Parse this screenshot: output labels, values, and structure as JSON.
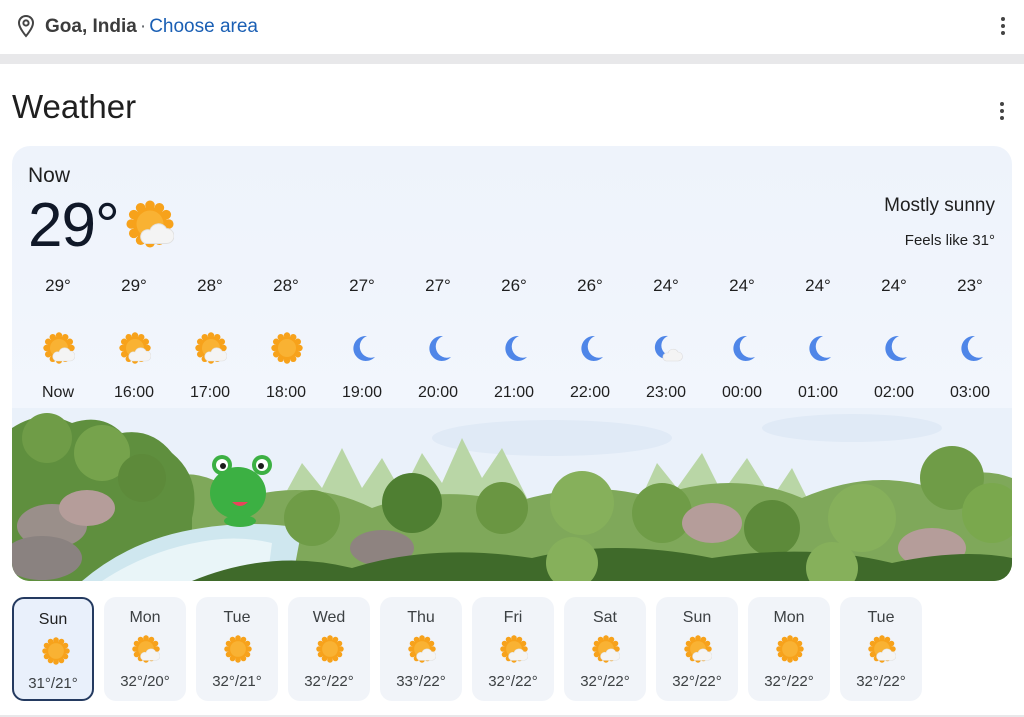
{
  "location": {
    "city": "Goa, India",
    "separator": "·",
    "choose": "Choose area"
  },
  "card_title": "Weather",
  "current": {
    "label": "Now",
    "temp": "29°",
    "condition": "Mostly sunny",
    "feels_like": "Feels like 31°",
    "icon": "sun-cloud-icon"
  },
  "hourly": [
    {
      "temp": "29°",
      "time": "Now",
      "icon": "sun-cloud-icon"
    },
    {
      "temp": "29°",
      "time": "16:00",
      "icon": "sun-cloud-icon"
    },
    {
      "temp": "28°",
      "time": "17:00",
      "icon": "sun-cloud-icon"
    },
    {
      "temp": "28°",
      "time": "18:00",
      "icon": "sun-icon"
    },
    {
      "temp": "27°",
      "time": "19:00",
      "icon": "moon-icon"
    },
    {
      "temp": "27°",
      "time": "20:00",
      "icon": "moon-icon"
    },
    {
      "temp": "26°",
      "time": "21:00",
      "icon": "moon-icon"
    },
    {
      "temp": "26°",
      "time": "22:00",
      "icon": "moon-icon"
    },
    {
      "temp": "24°",
      "time": "23:00",
      "icon": "moon-cloud-icon"
    },
    {
      "temp": "24°",
      "time": "00:00",
      "icon": "moon-icon"
    },
    {
      "temp": "24°",
      "time": "01:00",
      "icon": "moon-icon"
    },
    {
      "temp": "24°",
      "time": "02:00",
      "icon": "moon-icon"
    },
    {
      "temp": "23°",
      "time": "03:00",
      "icon": "moon-icon"
    }
  ],
  "daily": [
    {
      "day": "Sun",
      "temps": "31°/21°",
      "icon": "sun-icon",
      "selected": true
    },
    {
      "day": "Mon",
      "temps": "32°/20°",
      "icon": "sun-cloud-icon"
    },
    {
      "day": "Tue",
      "temps": "32°/21°",
      "icon": "sun-icon"
    },
    {
      "day": "Wed",
      "temps": "32°/22°",
      "icon": "sun-icon"
    },
    {
      "day": "Thu",
      "temps": "33°/22°",
      "icon": "sun-cloud-icon"
    },
    {
      "day": "Fri",
      "temps": "32°/22°",
      "icon": "sun-cloud-icon"
    },
    {
      "day": "Sat",
      "temps": "32°/22°",
      "icon": "sun-cloud-icon"
    },
    {
      "day": "Sun",
      "temps": "32°/22°",
      "icon": "sun-cloud-icon"
    },
    {
      "day": "Mon",
      "temps": "32°/22°",
      "icon": "sun-icon"
    },
    {
      "day": "Tue",
      "temps": "32°/22°",
      "icon": "sun-cloud-icon"
    }
  ],
  "colors": {
    "link": "#1a5fb4",
    "sun": "#f7a21b",
    "moon": "#4f86e8",
    "selected_border": "#243a60"
  }
}
